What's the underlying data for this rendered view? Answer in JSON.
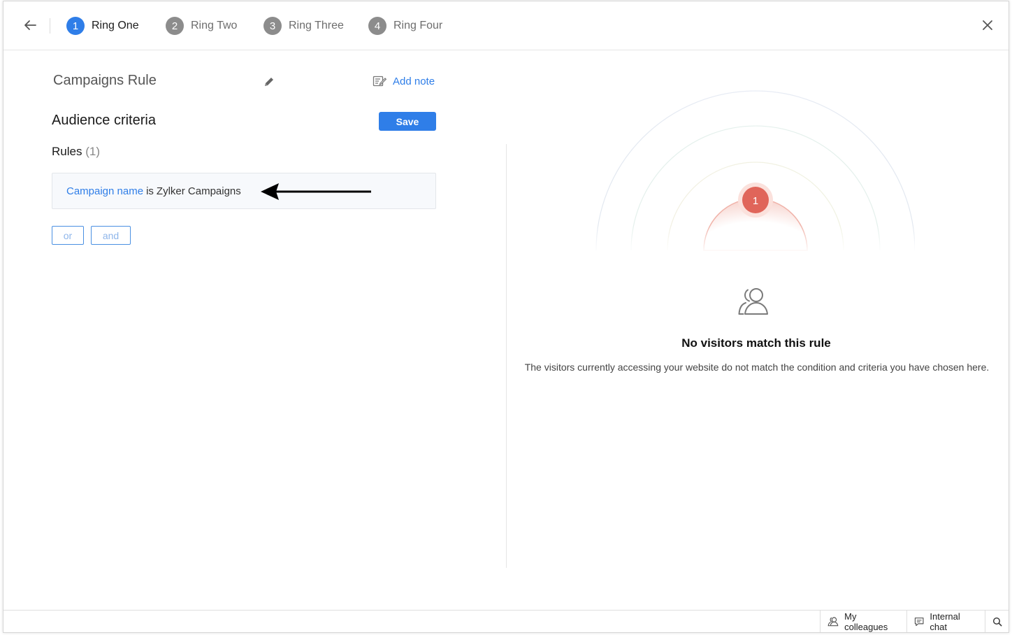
{
  "stepper": {
    "steps": [
      {
        "number": "1",
        "label": "Ring One",
        "active": true
      },
      {
        "number": "2",
        "label": "Ring Two",
        "active": false
      },
      {
        "number": "3",
        "label": "Ring Three",
        "active": false
      },
      {
        "number": "4",
        "label": "Ring Four",
        "active": false
      }
    ]
  },
  "rule": {
    "name": "Campaigns Rule",
    "add_note_label": "Add note"
  },
  "audience": {
    "title": "Audience criteria",
    "save_label": "Save",
    "rules_label": "Rules",
    "rules_count": "(1)",
    "condition": {
      "field": "Campaign name",
      "operator": "is",
      "value": "Zylker Campaigns"
    },
    "or_label": "or",
    "and_label": "and"
  },
  "preview": {
    "ring_badge": "1",
    "empty_title": "No visitors match this rule",
    "empty_description": "The visitors currently accessing your website do not match the condition and criteria you have chosen here."
  },
  "statusbar": {
    "colleagues_label": "My colleagues",
    "chat_label": "Internal chat"
  },
  "colors": {
    "accent": "#2f7ee8",
    "step_inactive": "#8c8c8c",
    "ring_badge": "#e0655a"
  },
  "icons": {
    "back": "arrow-left-icon",
    "close": "close-icon",
    "edit": "pencil-icon",
    "note": "note-icon",
    "people": "people-icon",
    "chat": "chat-icon",
    "search": "search-icon"
  }
}
